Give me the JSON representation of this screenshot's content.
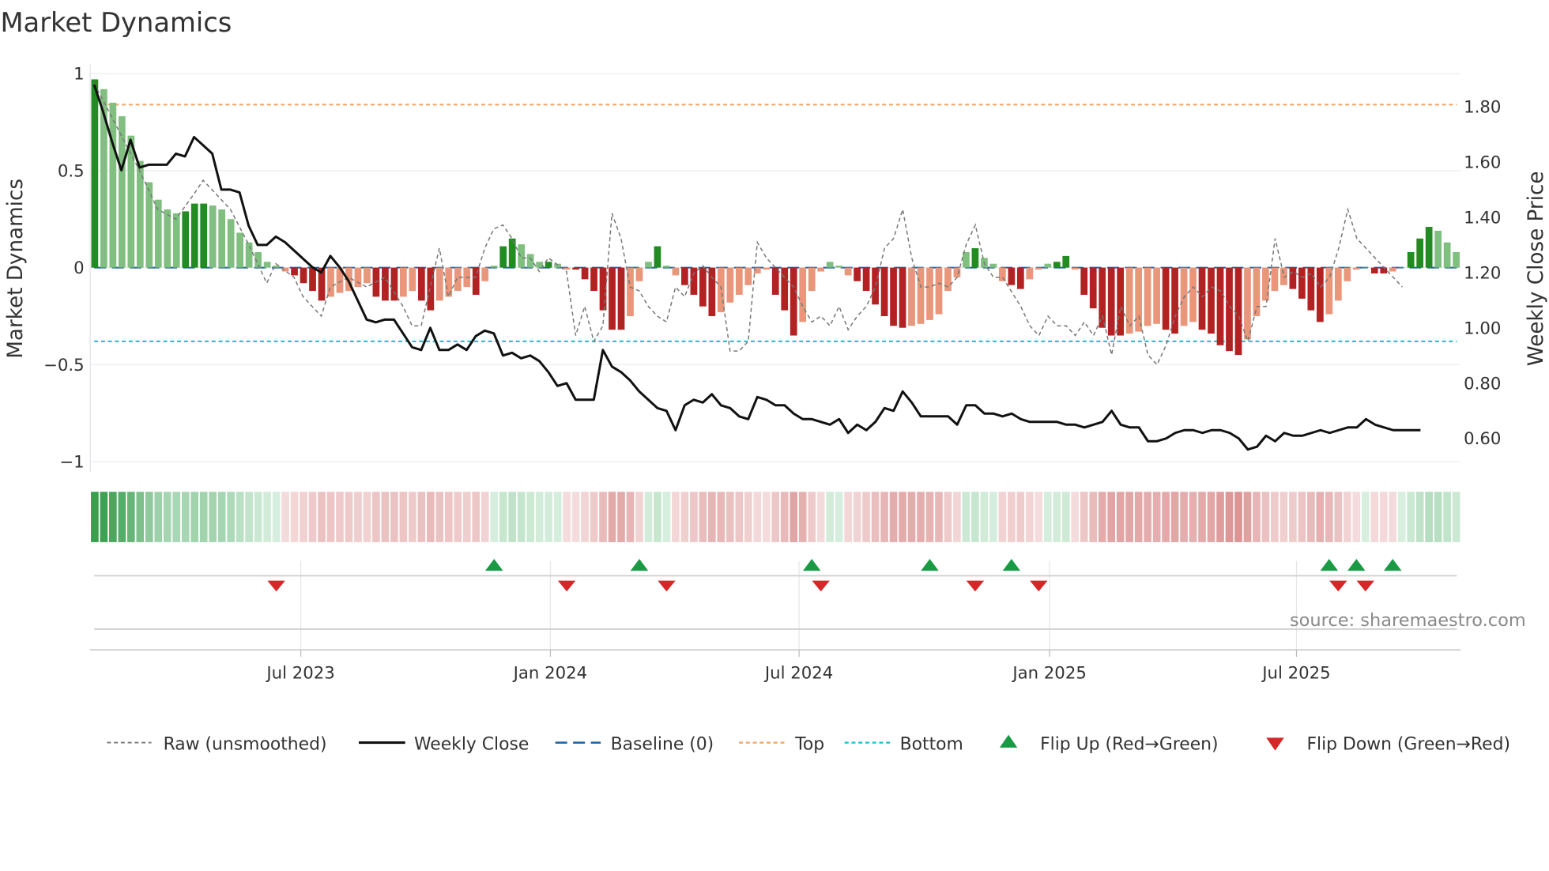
{
  "title": "Market Dynamics",
  "chart_data": {
    "type": "bar+line",
    "title": "Market Dynamics",
    "ylabel_left": "Market Dynamics",
    "ylabel_right": "Weekly Close Price",
    "ylim_left": [
      -1,
      1
    ],
    "ylim_right": [
      0.6,
      1.8
    ],
    "left_ticks": [
      {
        "v": 1,
        "label": "1"
      },
      {
        "v": 0.5,
        "label": "0.5"
      },
      {
        "v": 0,
        "label": "0"
      },
      {
        "v": -0.5,
        "label": "−0.5"
      },
      {
        "v": -1,
        "label": "−1"
      }
    ],
    "right_ticks": [
      {
        "v": 1.8,
        "label": "1.80"
      },
      {
        "v": 1.6,
        "label": "1.60"
      },
      {
        "v": 1.4,
        "label": "1.40"
      },
      {
        "v": 1.2,
        "label": "1.20"
      },
      {
        "v": 1.0,
        "label": "1.00"
      },
      {
        "v": 0.8,
        "label": "0.80"
      },
      {
        "v": 0.6,
        "label": "0.60"
      }
    ],
    "x_ticks": [
      {
        "week": 23.2,
        "label": "Jul 2023"
      },
      {
        "week": 50.7,
        "label": "Jan 2024"
      },
      {
        "week": 78.1,
        "label": "Jul 2024"
      },
      {
        "week": 105.7,
        "label": "Jan 2025"
      },
      {
        "week": 132.9,
        "label": "Jul 2025"
      }
    ],
    "top_level": 0.84,
    "bottom_level": -0.38,
    "baseline": 0,
    "dynamics": [
      0.97,
      0.92,
      0.85,
      0.78,
      0.68,
      0.55,
      0.44,
      0.35,
      0.3,
      0.28,
      0.29,
      0.33,
      0.33,
      0.32,
      0.3,
      0.25,
      0.18,
      0.13,
      0.08,
      0.03,
      0.01,
      -0.02,
      -0.04,
      -0.08,
      -0.12,
      -0.17,
      -0.15,
      -0.13,
      -0.12,
      -0.1,
      -0.08,
      -0.15,
      -0.17,
      -0.17,
      -0.15,
      -0.12,
      -0.17,
      -0.22,
      -0.17,
      -0.15,
      -0.12,
      -0.1,
      -0.14,
      -0.07,
      0.01,
      0.11,
      0.15,
      0.12,
      0.07,
      0.03,
      0.03,
      0.02,
      -0.01,
      -0.01,
      -0.06,
      -0.12,
      -0.22,
      -0.32,
      -0.32,
      -0.25,
      -0.07,
      0.03,
      0.11,
      0.01,
      -0.04,
      -0.09,
      -0.14,
      -0.2,
      -0.25,
      -0.23,
      -0.18,
      -0.14,
      -0.09,
      -0.03,
      -0.01,
      -0.14,
      -0.22,
      -0.35,
      -0.28,
      -0.12,
      -0.02,
      0.03,
      0.01,
      -0.04,
      -0.07,
      -0.12,
      -0.19,
      -0.25,
      -0.3,
      -0.31,
      -0.3,
      -0.29,
      -0.27,
      -0.24,
      -0.12,
      -0.05,
      0.08,
      0.1,
      0.05,
      0.02,
      -0.07,
      -0.09,
      -0.11,
      -0.06,
      -0.01,
      0.02,
      0.03,
      0.06,
      -0.01,
      -0.14,
      -0.21,
      -0.31,
      -0.35,
      -0.35,
      -0.34,
      -0.33,
      -0.3,
      -0.29,
      -0.32,
      -0.34,
      -0.3,
      -0.28,
      -0.32,
      -0.34,
      -0.4,
      -0.43,
      -0.45,
      -0.37,
      -0.25,
      -0.17,
      -0.12,
      -0.09,
      -0.11,
      -0.16,
      -0.22,
      -0.28,
      -0.24,
      -0.17,
      -0.07,
      -0.01,
      0.0,
      -0.03,
      -0.03,
      -0.02,
      0.0,
      0.08,
      0.15,
      0.21,
      0.19,
      0.13,
      0.08
    ],
    "weekly_close": [
      1.88,
      1.78,
      1.67,
      1.57,
      1.68,
      1.58,
      1.59,
      1.59,
      1.59,
      1.63,
      1.62,
      1.69,
      1.66,
      1.63,
      1.5,
      1.5,
      1.49,
      1.37,
      1.3,
      1.3,
      1.33,
      1.31,
      1.28,
      1.25,
      1.22,
      1.2,
      1.26,
      1.22,
      1.17,
      1.1,
      1.03,
      1.02,
      1.03,
      1.03,
      0.98,
      0.93,
      0.92,
      1.0,
      0.92,
      0.92,
      0.94,
      0.92,
      0.97,
      0.99,
      0.98,
      0.9,
      0.91,
      0.89,
      0.9,
      0.88,
      0.84,
      0.79,
      0.8,
      0.74,
      0.74,
      0.74,
      0.92,
      0.86,
      0.84,
      0.81,
      0.77,
      0.74,
      0.71,
      0.7,
      0.63,
      0.72,
      0.74,
      0.73,
      0.76,
      0.72,
      0.71,
      0.68,
      0.67,
      0.75,
      0.74,
      0.72,
      0.72,
      0.69,
      0.67,
      0.67,
      0.66,
      0.65,
      0.67,
      0.62,
      0.65,
      0.63,
      0.66,
      0.71,
      0.7,
      0.77,
      0.73,
      0.68,
      0.68,
      0.68,
      0.68,
      0.65,
      0.72,
      0.72,
      0.69,
      0.69,
      0.68,
      0.69,
      0.67,
      0.66,
      0.66,
      0.66,
      0.66,
      0.65,
      0.65,
      0.64,
      0.65,
      0.66,
      0.7,
      0.65,
      0.64,
      0.64,
      0.59,
      0.59,
      0.6,
      0.62,
      0.63,
      0.63,
      0.62,
      0.63,
      0.63,
      0.62,
      0.6,
      0.56,
      0.57,
      0.61,
      0.59,
      0.62,
      0.61,
      0.61,
      0.62,
      0.63,
      0.62,
      0.63,
      0.64,
      0.64,
      0.67,
      0.65,
      0.64,
      0.63,
      0.63,
      0.63,
      0.63
    ],
    "raw_unsmoothed": [
      [
        0,
        0.95
      ],
      [
        5,
        0.5
      ],
      [
        7,
        0.3
      ],
      [
        9,
        0.25
      ],
      [
        11,
        0.38
      ],
      [
        12,
        0.45
      ],
      [
        13,
        0.4
      ],
      [
        15,
        0.3
      ],
      [
        17,
        0.12
      ],
      [
        19,
        -0.08
      ],
      [
        20,
        0.02
      ],
      [
        22,
        -0.05
      ],
      [
        23,
        -0.15
      ],
      [
        25,
        -0.25
      ],
      [
        26,
        -0.1
      ],
      [
        28,
        -0.05
      ],
      [
        30,
        -0.1
      ],
      [
        32,
        -0.05
      ],
      [
        34,
        -0.2
      ],
      [
        35,
        -0.3
      ],
      [
        36,
        -0.3
      ],
      [
        37,
        -0.1
      ],
      [
        38,
        0.1
      ],
      [
        39,
        -0.15
      ],
      [
        40,
        -0.05
      ],
      [
        42,
        -0.05
      ],
      [
        43,
        0.1
      ],
      [
        44,
        0.2
      ],
      [
        45,
        0.22
      ],
      [
        46,
        0.15
      ],
      [
        47,
        0.05
      ],
      [
        48,
        0.05
      ],
      [
        49,
        -0.02
      ],
      [
        50,
        0.05
      ],
      [
        52,
        -0.02
      ],
      [
        53,
        -0.35
      ],
      [
        54,
        -0.2
      ],
      [
        55,
        -0.38
      ],
      [
        56,
        -0.3
      ],
      [
        57,
        0.28
      ],
      [
        58,
        0.15
      ],
      [
        59,
        -0.1
      ],
      [
        60,
        -0.12
      ],
      [
        61,
        -0.2
      ],
      [
        62,
        -0.25
      ],
      [
        63,
        -0.28
      ],
      [
        64,
        -0.1
      ],
      [
        65,
        -0.15
      ],
      [
        66,
        -0.03
      ],
      [
        67,
        0.01
      ],
      [
        68,
        -0.05
      ],
      [
        69,
        -0.1
      ],
      [
        70,
        -0.43
      ],
      [
        71,
        -0.43
      ],
      [
        72,
        -0.38
      ],
      [
        73,
        0.13
      ],
      [
        74,
        0.05
      ],
      [
        75,
        0.0
      ],
      [
        76,
        -0.05
      ],
      [
        77,
        -0.1
      ],
      [
        78,
        -0.2
      ],
      [
        79,
        -0.28
      ],
      [
        80,
        -0.25
      ],
      [
        81,
        -0.3
      ],
      [
        82,
        -0.2
      ],
      [
        83,
        -0.32
      ],
      [
        84,
        -0.25
      ],
      [
        85,
        -0.2
      ],
      [
        86,
        -0.1
      ],
      [
        87,
        0.1
      ],
      [
        88,
        0.15
      ],
      [
        89,
        0.3
      ],
      [
        90,
        0.05
      ],
      [
        91,
        -0.1
      ],
      [
        92,
        -0.1
      ],
      [
        93,
        -0.08
      ],
      [
        94,
        -0.1
      ],
      [
        95,
        -0.05
      ],
      [
        96,
        0.12
      ],
      [
        97,
        0.22
      ],
      [
        98,
        0.02
      ],
      [
        99,
        -0.05
      ],
      [
        100,
        -0.05
      ],
      [
        102,
        -0.2
      ],
      [
        103,
        -0.3
      ],
      [
        104,
        -0.35
      ],
      [
        105,
        -0.25
      ],
      [
        106,
        -0.3
      ],
      [
        107,
        -0.3
      ],
      [
        108,
        -0.35
      ],
      [
        109,
        -0.28
      ],
      [
        110,
        -0.35
      ],
      [
        111,
        -0.25
      ],
      [
        112,
        -0.45
      ],
      [
        113,
        -0.2
      ],
      [
        114,
        -0.3
      ],
      [
        115,
        -0.25
      ],
      [
        116,
        -0.45
      ],
      [
        117,
        -0.5
      ],
      [
        118,
        -0.4
      ],
      [
        119,
        -0.25
      ],
      [
        120,
        -0.15
      ],
      [
        121,
        -0.1
      ],
      [
        122,
        -0.15
      ],
      [
        123,
        -0.1
      ],
      [
        124,
        -0.12
      ],
      [
        125,
        -0.2
      ],
      [
        126,
        -0.25
      ],
      [
        127,
        -0.38
      ],
      [
        128,
        -0.2
      ],
      [
        129,
        -0.2
      ],
      [
        130,
        0.15
      ],
      [
        131,
        -0.05
      ],
      [
        132,
        -0.02
      ],
      [
        133,
        -0.05
      ],
      [
        134,
        -0.03
      ],
      [
        135,
        -0.1
      ],
      [
        136,
        -0.05
      ],
      [
        137,
        0.1
      ],
      [
        138,
        0.3
      ],
      [
        139,
        0.15
      ],
      [
        140,
        0.1
      ],
      [
        141,
        0.05
      ],
      [
        142,
        0.0
      ],
      [
        144,
        -0.1
      ]
    ],
    "flip_up_weeks": [
      44,
      60,
      79,
      92,
      101,
      136,
      139,
      143
    ],
    "flip_down_weeks": [
      20,
      52,
      63,
      80,
      97,
      104,
      137,
      140
    ],
    "legend_position": "bottom",
    "legend": {
      "raw": "Raw (unsmoothed)",
      "close": "Weekly Close",
      "baseline": "Baseline (0)",
      "top": "Top",
      "bottom": "Bottom",
      "flip_up": "Flip Up (Red→Green)",
      "flip_down": "Flip Down (Green→Red)"
    }
  },
  "source": "source: sharemaestro.com",
  "colors": {
    "green_dark": "#228b22",
    "green_light": "#80bf80",
    "red_dark": "#b22222",
    "red_light": "#e9967a",
    "close": "#111111",
    "raw": "#777777",
    "baseline": "#1f5f9f",
    "top": "#f4a460",
    "bottom": "#17becf",
    "flip_up": "#1a9a44",
    "flip_down": "#d62728"
  }
}
